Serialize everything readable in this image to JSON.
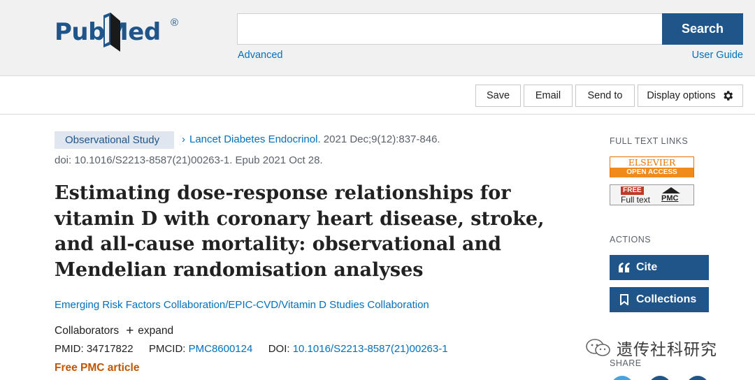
{
  "header": {
    "logo_text": "PubMed",
    "logo_reg": "®",
    "search_placeholder": "",
    "search_value": "",
    "search_button": "Search",
    "advanced_link": "Advanced",
    "user_guide_link": "User Guide"
  },
  "toolbar": {
    "save": "Save",
    "email": "Email",
    "send_to": "Send to",
    "display_options": "Display options"
  },
  "article": {
    "type_badge": "Observational Study",
    "journal": "Lancet Diabetes Endocrinol.",
    "citation_detail": "2021 Dec;9(12):837-846.",
    "doi_line": "doi: 10.1016/S2213-8587(21)00263-1. Epub 2021 Oct 28.",
    "title": "Estimating dose-response relationships for vitamin D with coronary heart disease, stroke, and all-cause mortality: observational and Mendelian randomisation analyses",
    "authors": "Emerging Risk Factors Collaboration/EPIC-CVD/Vitamin D Studies Collaboration",
    "collaborators_label": "Collaborators",
    "expand_label": "expand",
    "pmid_label": "PMID:",
    "pmid": "34717822",
    "pmcid_label": "PMCID:",
    "pmcid": "PMC8600124",
    "doi_label": "DOI:",
    "doi": "10.1016/S2213-8587(21)00263-1",
    "free_pmc": "Free PMC article"
  },
  "sidebar": {
    "full_text_links_heading": "FULL TEXT LINKS",
    "elsevier_top": "ELSEVIER",
    "elsevier_bottom": "OPEN ACCESS",
    "pmc_free": "FREE",
    "pmc_fulltext": "Full text",
    "pmc_label": "PMC",
    "actions_heading": "ACTIONS",
    "cite_label": "Cite",
    "collections_label": "Collections",
    "share_heading": "SHARE"
  },
  "watermark": {
    "text": "遗传社科研究"
  },
  "colors": {
    "brand": "#20558a",
    "link": "#0071bc",
    "free_pmc": "#c05600",
    "header_bg": "#f1f1f1"
  },
  "icons": {
    "gear": "gear-icon",
    "quote": "quote-icon",
    "bookmark": "bookmark-icon",
    "plus": "plus-icon",
    "chevron": "chevron-right-icon"
  }
}
